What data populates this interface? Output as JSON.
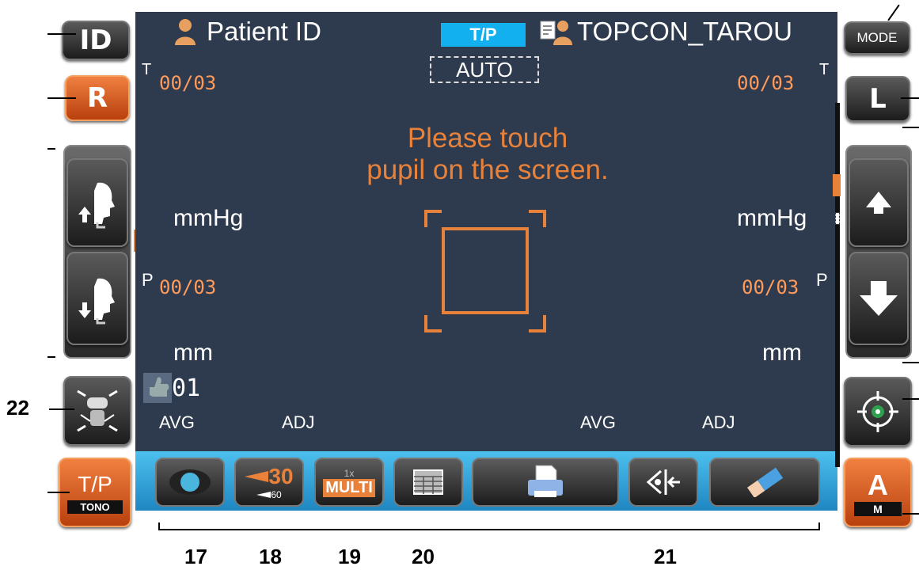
{
  "header": {
    "patient_id_label": "Patient ID",
    "mode_badge": "T/P",
    "operator_name": "TOPCON_TAROU",
    "auto_label": "AUTO"
  },
  "right_eye": {
    "t_marker": "T",
    "t_value": "00/03",
    "t_unit": "mmHg",
    "p_marker": "P",
    "p_value": "00/03",
    "p_unit": "mm",
    "avg_label": "AVG",
    "adj_label": "ADJ",
    "count": "01"
  },
  "left_eye": {
    "t_marker": "T",
    "t_value": "00/03",
    "t_unit": "mmHg",
    "p_marker": "P",
    "p_value": "00/03",
    "p_unit": "mm",
    "avg_label": "AVG",
    "adj_label": "ADJ"
  },
  "message": {
    "line1": "Please touch",
    "line2": "pupil on the screen."
  },
  "left_buttons": {
    "id_label": "ID",
    "r_label": "R",
    "tp_label": "T/P",
    "tono_label": "TONO"
  },
  "right_buttons": {
    "mode_label": "MODE",
    "l_label": "L",
    "a_label": "A",
    "m_label": "M"
  },
  "toolbar": {
    "distance_big": "30",
    "distance_small": "60",
    "multi_top": "1x",
    "multi_label": "MULTI"
  },
  "callouts": {
    "n17": "17",
    "n18": "18",
    "n19": "19",
    "n20": "20",
    "n21": "21",
    "n22": "22"
  },
  "colors": {
    "screen_bg": "#2e3b4e",
    "accent_orange": "#e8813a",
    "badge_blue": "#12b0ee",
    "toolbar_blue": "#2fa5dc"
  },
  "icons": [
    "user-icon",
    "operator-card-icon",
    "chin-up-icon",
    "chin-down-icon",
    "face-align-icon",
    "arrow-up-icon",
    "arrow-down-icon",
    "target-icon",
    "eye-lens-icon",
    "printer-icon",
    "eye-adjust-icon",
    "eraser-icon",
    "table-icon"
  ]
}
